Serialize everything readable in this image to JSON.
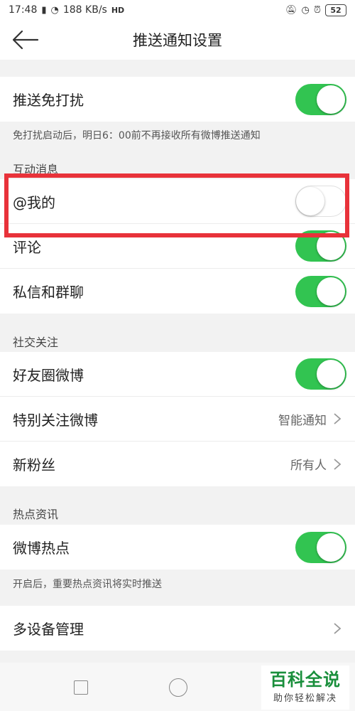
{
  "status_bar": {
    "time": "17:48",
    "network_speed": "188 KB/s",
    "hd_label": "HD",
    "battery": "52"
  },
  "header": {
    "title": "推送通知设置"
  },
  "dnd": {
    "label": "推送免打扰",
    "enabled": true,
    "hint": "免打扰启动后，明日6：00前不再接收所有微博推送通知"
  },
  "interaction": {
    "title": "互动消息",
    "items": [
      {
        "label": "@我的",
        "enabled": false
      },
      {
        "label": "评论",
        "enabled": true
      },
      {
        "label": "私信和群聊",
        "enabled": true
      }
    ]
  },
  "social": {
    "title": "社交关注",
    "items": [
      {
        "label": "好友圈微博",
        "enabled": true
      },
      {
        "label": "特别关注微博",
        "value": "智能通知"
      },
      {
        "label": "新粉丝",
        "value": "所有人"
      }
    ]
  },
  "hot": {
    "title": "热点资讯",
    "label": "微博热点",
    "enabled": true,
    "hint": "开启后，重要热点资讯将实时推送"
  },
  "devices": {
    "label": "多设备管理"
  },
  "watermark": {
    "main": "百科全说",
    "sub": "助你轻松解决"
  },
  "colors": {
    "toggle_on": "#32c451",
    "highlight": "#e8323a"
  }
}
